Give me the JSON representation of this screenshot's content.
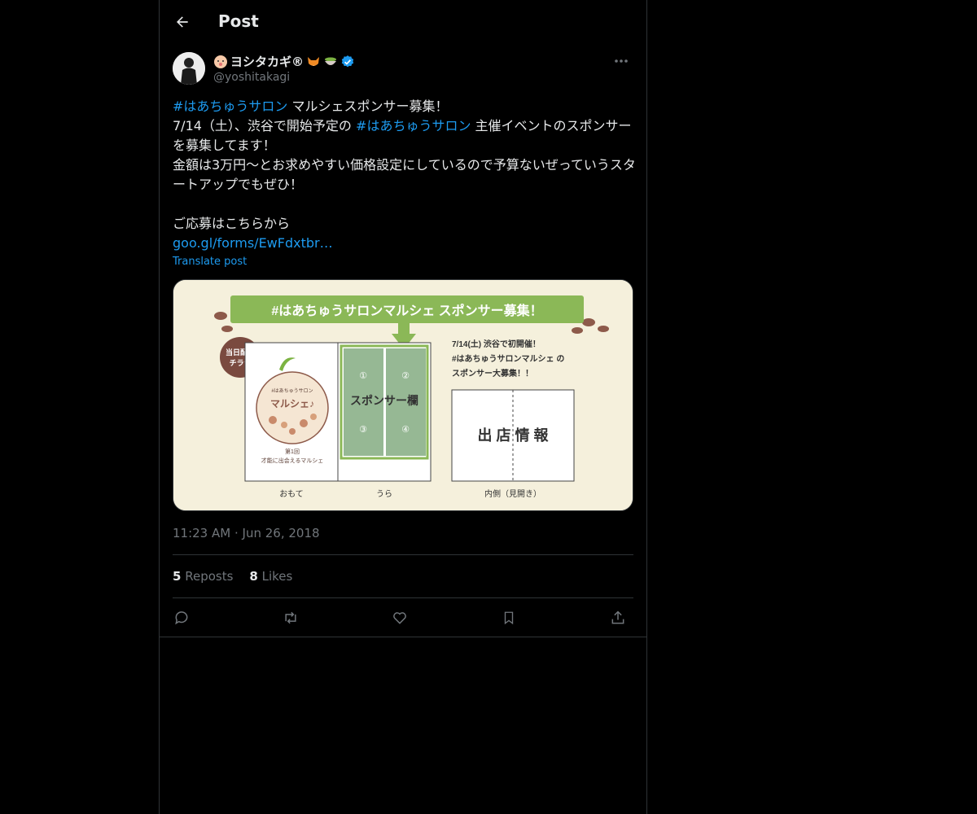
{
  "header": {
    "title": "Post"
  },
  "author": {
    "display_name": "ヨシタカギ®",
    "handle": "@yoshitakagi",
    "verified_color": "#1d9bf0"
  },
  "tweet": {
    "hashtag1": "#はあちゅうサロン",
    "line1_rest": " マルシェスポンサー募集！",
    "line2_pre": "7/14（土）、渋谷で開始予定の ",
    "hashtag2": "#はあちゅうサロン",
    "line2_post": " 主催イベントのスポンサーを募集してます！",
    "line3": "金額は3万円〜とお求めやすい価格設定にしているので予算ないぜっていうスタートアップでもぜひ！",
    "line4": "ご応募はこちらから",
    "link": "goo.gl/forms/EwFdxtbr…",
    "translate": "Translate post"
  },
  "media": {
    "banner": "#はあちゅうサロンマルシェ スポンサー募集！",
    "badge_line1": "当日配布",
    "badge_line2": "チラシ",
    "circle_top": "#はあちゅうサロン",
    "circle_main": "マルシェ♪",
    "circle_sub1": "第1回",
    "circle_sub2": "才能に出会えるマルシェ",
    "sponsor_label": "スポンサー欄",
    "n1": "①",
    "n2": "②",
    "n3": "③",
    "n4": "④",
    "right_line1": "7/14(土) 渋谷で初開催！",
    "right_line2": "#はあちゅうサロンマルシェ の",
    "right_line3": "スポンサー大募集！！",
    "info_label": "出 店 情 報",
    "cap_front": "おもて",
    "cap_back": "うら",
    "cap_inside": "内側（見開き）"
  },
  "meta": {
    "time": "11:23 AM",
    "separator": "·",
    "date": "Jun 26, 2018"
  },
  "stats": {
    "reposts_count": "5",
    "reposts_label": "Reposts",
    "likes_count": "8",
    "likes_label": "Likes"
  },
  "icons": [
    "back-arrow-icon",
    "more-icon",
    "reply-icon",
    "repost-icon",
    "like-icon",
    "bookmark-icon",
    "share-icon",
    "verified-icon"
  ]
}
